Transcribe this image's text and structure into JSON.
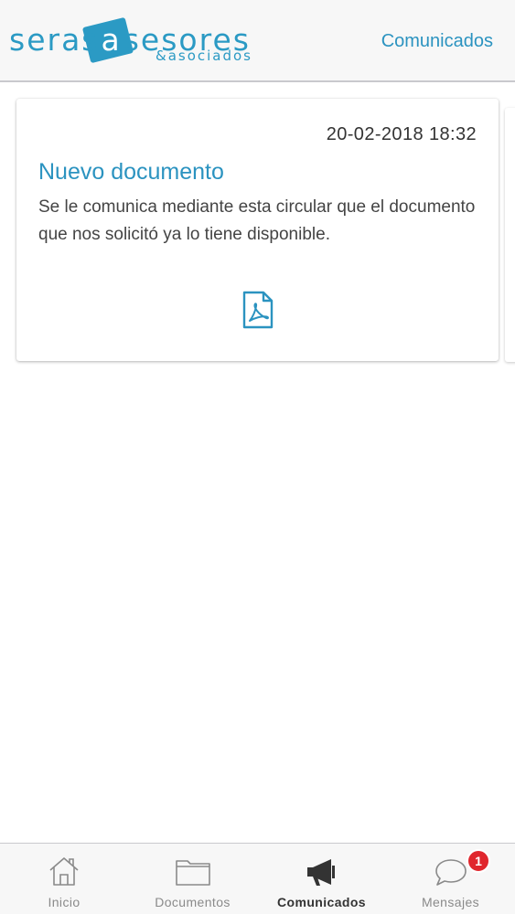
{
  "header": {
    "logo": {
      "part1": "seras",
      "part2": "a",
      "part3": "sesores",
      "sub": "&asociados"
    },
    "title": "Comunicados"
  },
  "cards": [
    {
      "date": "20-02-2018 18:32",
      "title": "Nuevo documento",
      "body": "Se le comunica mediante esta circular que el documento que nos solicitó ya lo tiene disponible.",
      "attachment_icon": "pdf-icon"
    }
  ],
  "tabbar": {
    "items": [
      {
        "label": "Inicio",
        "icon": "home-icon"
      },
      {
        "label": "Documentos",
        "icon": "folder-icon"
      },
      {
        "label": "Comunicados",
        "icon": "megaphone-icon",
        "active": true
      },
      {
        "label": "Mensajes",
        "icon": "chat-bubble-icon",
        "badge": "1"
      }
    ]
  },
  "colors": {
    "accent": "#2b93c0",
    "badge": "#e0262d",
    "bar_background": "#f7f7f7"
  }
}
